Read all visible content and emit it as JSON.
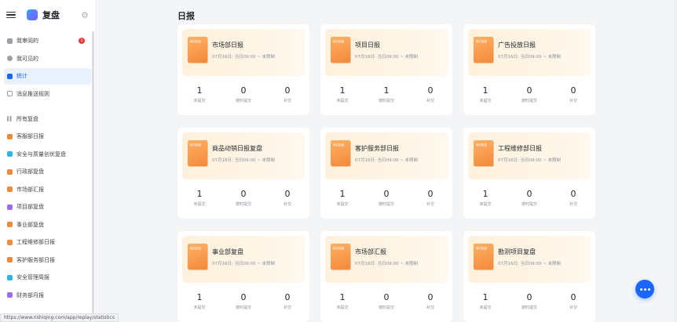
{
  "sidebar": {
    "title": "复盘",
    "items": [
      {
        "label": "我审阅的",
        "badge": "1"
      },
      {
        "label": "我可见的"
      },
      {
        "label": "统计"
      },
      {
        "label": "消息推送规则"
      },
      {
        "label": "所有复盘"
      },
      {
        "label": "客服部日报"
      },
      {
        "label": "安全与质量创优复盘"
      },
      {
        "label": "行政部复盘"
      },
      {
        "label": "市场部汇报"
      },
      {
        "label": "项目部复盘"
      },
      {
        "label": "事业部复盘"
      },
      {
        "label": "工程维修部日报"
      },
      {
        "label": "客护服务部日报"
      },
      {
        "label": "安全管理周报"
      },
      {
        "label": "财务部月报"
      }
    ]
  },
  "status_url": "https://www.rishiqing.com/app/replay/statistics",
  "page_title": "日报",
  "card_thumb_text": "每日复盘",
  "stat_labels": {
    "unsubmitted": "未提交",
    "ontime": "按时提交",
    "makeup": "补交"
  },
  "cards": [
    {
      "name": "市场部日报",
      "time": "07月16日: 当日09:00 ~ 未限制",
      "unsubmitted": "1",
      "ontime": "0",
      "makeup": "0"
    },
    {
      "name": "项目日报",
      "time": "07月16日: 当日09:00 ~ 未限制",
      "unsubmitted": "1",
      "ontime": "1",
      "makeup": "0"
    },
    {
      "name": "广告投放日报",
      "time": "07月16日: 当日09:00 ~ 未限制",
      "unsubmitted": "1",
      "ontime": "0",
      "makeup": "0"
    },
    {
      "name": "商品动销日报复盘",
      "time": "07月16日: 当日09:00 ~ 未限制",
      "unsubmitted": "1",
      "ontime": "0",
      "makeup": "0"
    },
    {
      "name": "客护服务部日报",
      "time": "07月16日: 当日09:00 ~ 未限制",
      "unsubmitted": "1",
      "ontime": "0",
      "makeup": "0"
    },
    {
      "name": "工程维修部日报",
      "time": "07月16日: 当日09:00 ~ 未限制",
      "unsubmitted": "1",
      "ontime": "0",
      "makeup": "0"
    },
    {
      "name": "事业部复盘",
      "time": "07月16日: 当日09:00 ~ 未限制",
      "unsubmitted": "1",
      "ontime": "0",
      "makeup": "0"
    },
    {
      "name": "市场部汇报",
      "time": "07月16日: 当日09:00 ~ 未限制",
      "unsubmitted": "1",
      "ontime": "0",
      "makeup": "0"
    },
    {
      "name": "勘测项目复盘",
      "time": "07月16日: 当日09:00 ~ 未限制",
      "unsubmitted": "1",
      "ontime": "0",
      "makeup": "0"
    }
  ],
  "colors": {
    "accent": "#1a66ff",
    "badge": "#f0353d",
    "card_header": "#fff1dc",
    "book": "#f3893a"
  },
  "icons": {
    "menu": "menu-icon",
    "settings": "gear-icon",
    "more": "more-icon"
  }
}
